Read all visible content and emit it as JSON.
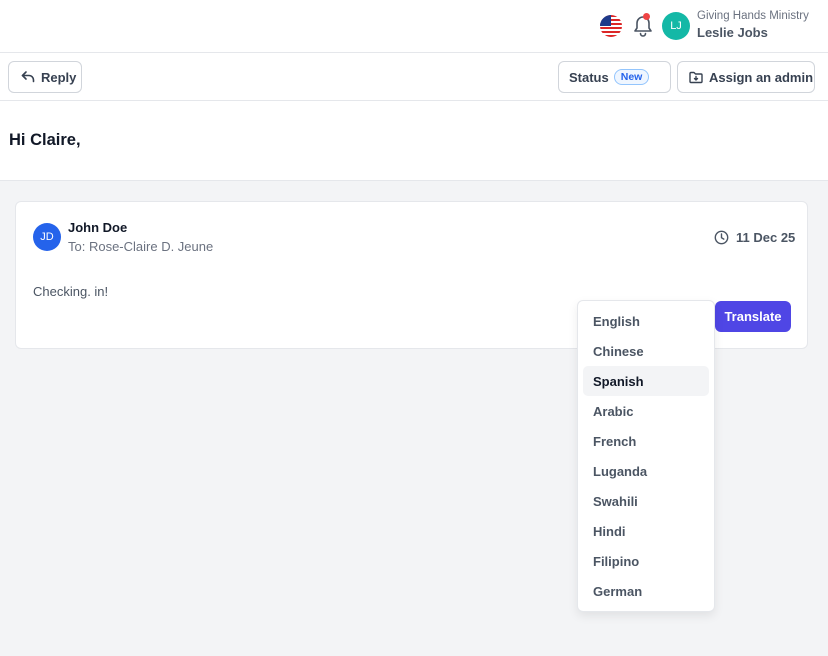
{
  "header": {
    "language_icon": "us-flag-icon",
    "notification_icon": "bell-icon",
    "user_initials": "LJ",
    "organization": "Giving Hands Ministry",
    "user_name": "Leslie Jobs",
    "colors": {
      "avatar": "#14b8a6",
      "notification_dot": "#ef4444"
    }
  },
  "toolbar": {
    "reply_label": "Reply",
    "status_label": "Status",
    "status_badge": "New",
    "assign_label": "Assign an admin"
  },
  "greeting": "Hi Claire,",
  "message": {
    "sender_initials": "JD",
    "sender_name": "John Doe",
    "recipient": "To: Rose-Claire D. Jeune",
    "date": "11 Dec 25",
    "body": "Checking. in!",
    "translate_label": "Translate",
    "colors": {
      "avatar": "#2563eb",
      "translate_button": "#4f46e5"
    }
  },
  "language_menu": {
    "options": [
      "English",
      "Chinese",
      "Spanish",
      "Arabic",
      "French",
      "Luganda",
      "Swahili",
      "Hindi",
      "Filipino",
      "German"
    ],
    "selected": "Spanish"
  }
}
